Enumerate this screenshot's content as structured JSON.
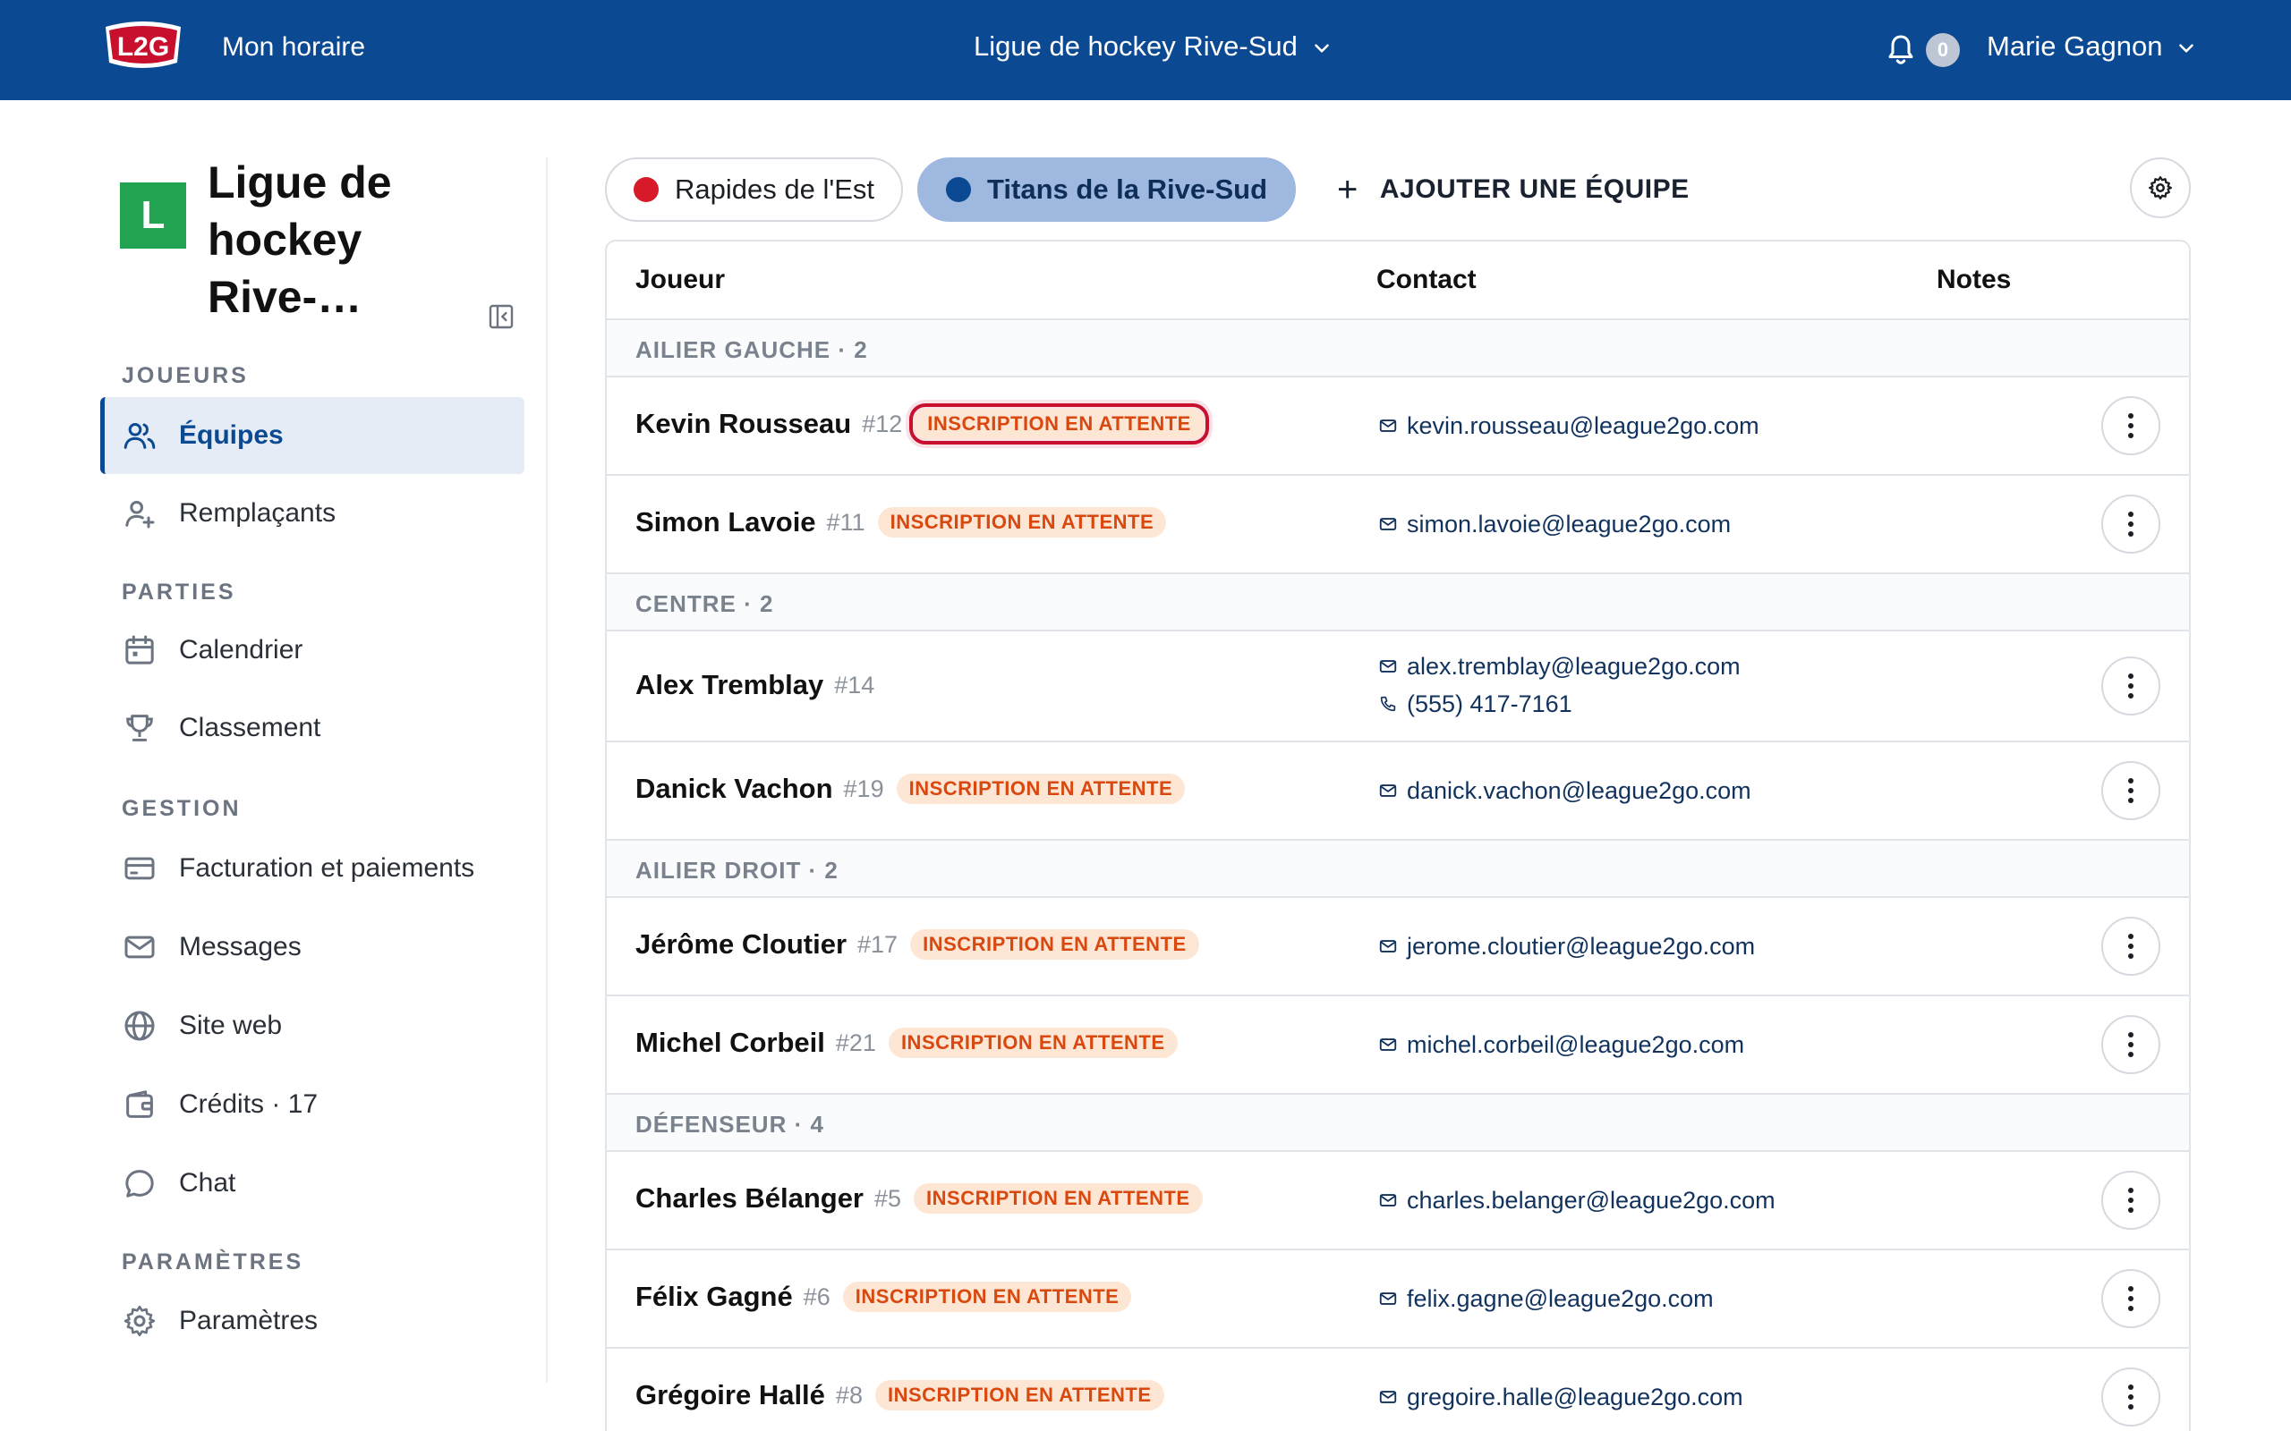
{
  "topbar": {
    "logo_text": "L2G",
    "nav_link": "Mon horaire",
    "league_select": "Ligue de hockey Rive-Sud",
    "notifications_count": "0",
    "user_name": "Marie Gagnon"
  },
  "sidebar": {
    "org_initial": "L",
    "org_name": "Ligue de hockey Rive-…",
    "sections": {
      "joueurs": "JOUEURS",
      "parties": "PARTIES",
      "gestion": "GESTION",
      "parametres": "PARAMÈTRES"
    },
    "items": {
      "equipes": "Équipes",
      "remplacants": "Remplaçants",
      "calendrier": "Calendrier",
      "classement": "Classement",
      "facturation": "Facturation et paiements",
      "messages": "Messages",
      "site_web": "Site web",
      "credits": "Crédits · 17",
      "chat": "Chat",
      "parametres": "Paramètres"
    }
  },
  "teams": {
    "tabs": [
      {
        "label": "Rapides de l'Est",
        "color": "#d7192a"
      },
      {
        "label": "Titans de la Rive-Sud",
        "color": "#0b4a92"
      }
    ],
    "add_label": "AJOUTER UNE ÉQUIPE"
  },
  "table": {
    "headers": {
      "player": "Joueur",
      "contact": "Contact",
      "notes": "Notes"
    },
    "groups": {
      "ailier_gauche": "AILIER GAUCHE · 2",
      "centre": "CENTRE · 2",
      "ailier_droit": "AILIER DROIT · 2",
      "defenseur": "DÉFENSEUR · 4"
    },
    "badge_label": "INSCRIPTION EN ATTENTE",
    "players": [
      {
        "name": "Kevin Rousseau",
        "number": "#12",
        "email": "kevin.rousseau@league2go.com"
      },
      {
        "name": "Simon Lavoie",
        "number": "#11",
        "email": "simon.lavoie@league2go.com"
      },
      {
        "name": "Alex Tremblay",
        "number": "#14",
        "email": "alex.tremblay@league2go.com",
        "phone": "(555) 417-7161"
      },
      {
        "name": "Danick Vachon",
        "number": "#19",
        "email": "danick.vachon@league2go.com"
      },
      {
        "name": "Jérôme Cloutier",
        "number": "#17",
        "email": "jerome.cloutier@league2go.com"
      },
      {
        "name": "Michel Corbeil",
        "number": "#21",
        "email": "michel.corbeil@league2go.com"
      },
      {
        "name": "Charles Bélanger",
        "number": "#5",
        "email": "charles.belanger@league2go.com"
      },
      {
        "name": "Félix Gagné",
        "number": "#6",
        "email": "felix.gagne@league2go.com"
      },
      {
        "name": "Grégoire Hallé",
        "number": "#8",
        "email": "gregoire.halle@league2go.com"
      }
    ]
  }
}
